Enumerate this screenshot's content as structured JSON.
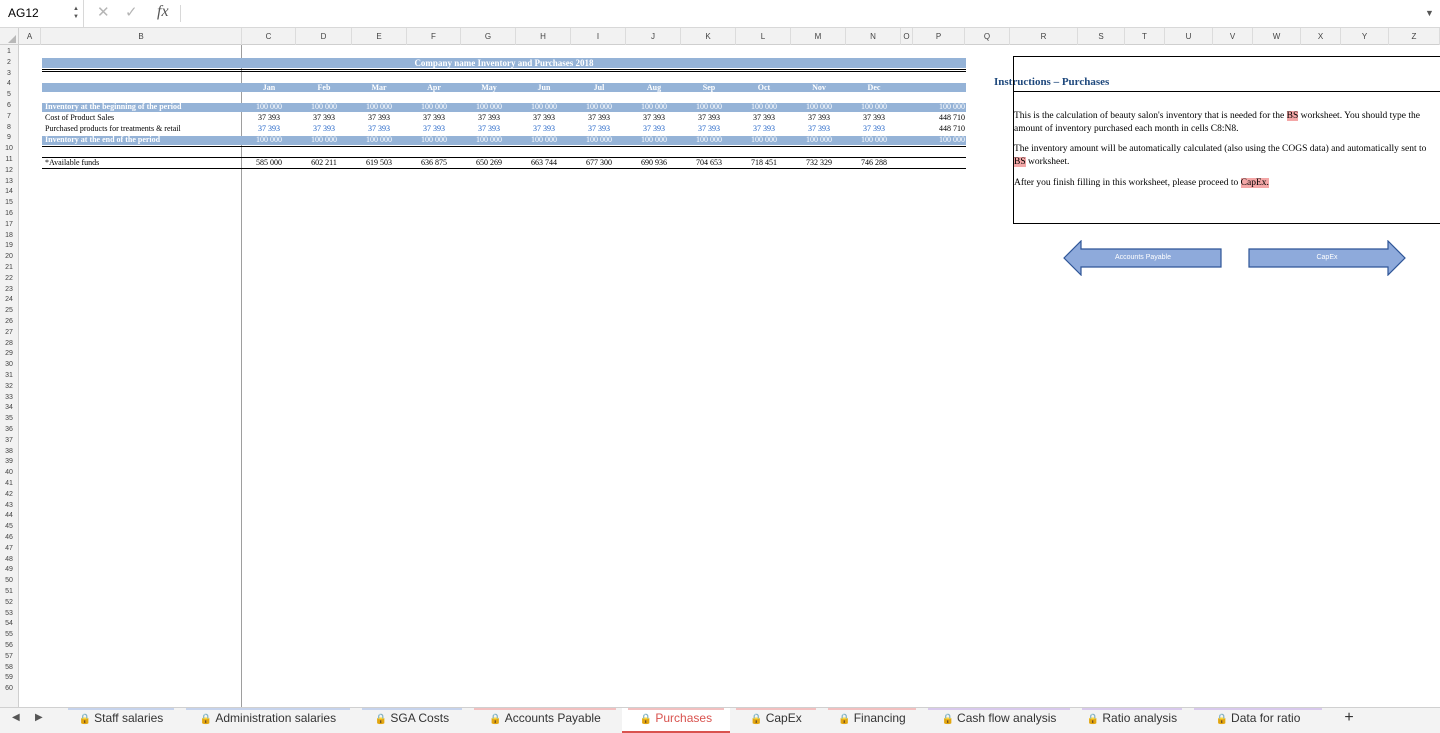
{
  "formula_bar": {
    "name_box": "AG12",
    "cancel_icon": "✕",
    "enter_icon": "✓",
    "fx_label": "fx",
    "formula": ""
  },
  "columns": [
    "A",
    "B",
    "C",
    "D",
    "E",
    "F",
    "G",
    "H",
    "I",
    "J",
    "K",
    "L",
    "M",
    "N",
    "O",
    "P",
    "Q",
    "R",
    "S",
    "T",
    "U",
    "V",
    "W",
    "X",
    "Y",
    "Z"
  ],
  "row_count": 60,
  "sheet": {
    "title": "Company name Inventory and Purchases 2018",
    "months": [
      "Jan",
      "Feb",
      "Mar",
      "Apr",
      "May",
      "Jun",
      "Jul",
      "Aug",
      "Sep",
      "Oct",
      "Nov",
      "Dec"
    ],
    "rows": [
      {
        "label": "Inventory at the beginning of the period",
        "values": [
          "100 000",
          "100 000",
          "100 000",
          "100 000",
          "100 000",
          "100 000",
          "100 000",
          "100 000",
          "100 000",
          "100 000",
          "100 000",
          "100 000"
        ],
        "total": "100 000"
      },
      {
        "label": "Cost of Product Sales",
        "values": [
          "37 393",
          "37 393",
          "37 393",
          "37 393",
          "37 393",
          "37 393",
          "37 393",
          "37 393",
          "37 393",
          "37 393",
          "37 393",
          "37 393"
        ],
        "total": "448 710"
      },
      {
        "label": "Purchased products for treatments & retail",
        "values": [
          "37 393",
          "37 393",
          "37 393",
          "37 393",
          "37 393",
          "37 393",
          "37 393",
          "37 393",
          "37 393",
          "37 393",
          "37 393",
          "37 393"
        ],
        "total": "448 710"
      },
      {
        "label": "Inventory at the end of the period",
        "values": [
          "100 000",
          "100 000",
          "100 000",
          "100 000",
          "100 000",
          "100 000",
          "100 000",
          "100 000",
          "100 000",
          "100 000",
          "100 000",
          "100 000"
        ],
        "total": "100 000"
      }
    ],
    "funds": {
      "label": "*Available funds",
      "values": [
        "585 000",
        "602 211",
        "619 503",
        "636 875",
        "650 269",
        "663 744",
        "677 300",
        "690 936",
        "704 653",
        "718 451",
        "732 329",
        "746 288"
      ]
    }
  },
  "instructions": {
    "title": "Instructions – Purchases",
    "p1_a": "This is the calculation of beauty salon's inventory that is needed for the ",
    "p1_hl": "BS",
    "p1_b": " worksheet. You should type the amount of inventory purchased each month in cells C8:N8.",
    "p2_a": "The inventory amount will be automatically calculated (also using the COGS data) and automatically sent to ",
    "p2_hl": "BS",
    "p2_b": " worksheet.",
    "p3_a": "After you finish filling in this worksheet, please proceed to ",
    "p3_hl": "CapEx."
  },
  "buttons": {
    "back": "Accounts Payable",
    "next": "CapEx"
  },
  "colors": {
    "header_fill": "#95b3d7",
    "blue_text": "#1f62c7",
    "arrow_fill": "#8eaadb",
    "arrow_border": "#2e5597",
    "active_tab": "#d9534f"
  },
  "tabs": [
    {
      "label": "Staff salaries",
      "active": false,
      "color": "#c6d3ec"
    },
    {
      "label": "Administration salaries",
      "active": false,
      "color": "#c6d3ec"
    },
    {
      "label": "SGA Costs",
      "active": false,
      "color": "#c6d3ec"
    },
    {
      "label": "Accounts Payable",
      "active": false,
      "color": "#f2c0c0"
    },
    {
      "label": "Purchases",
      "active": true,
      "color": "#f2c0c0"
    },
    {
      "label": "CapEx",
      "active": false,
      "color": "#f2c0c0"
    },
    {
      "label": "Financing",
      "active": false,
      "color": "#f2c0c0"
    },
    {
      "label": "Cash flow analysis",
      "active": false,
      "color": "#d8c9ec"
    },
    {
      "label": "Ratio analysis",
      "active": false,
      "color": "#d8c9ec"
    },
    {
      "label": "Data for ratio",
      "active": false,
      "color": "#d8c9ec"
    }
  ],
  "add_tab": "+"
}
